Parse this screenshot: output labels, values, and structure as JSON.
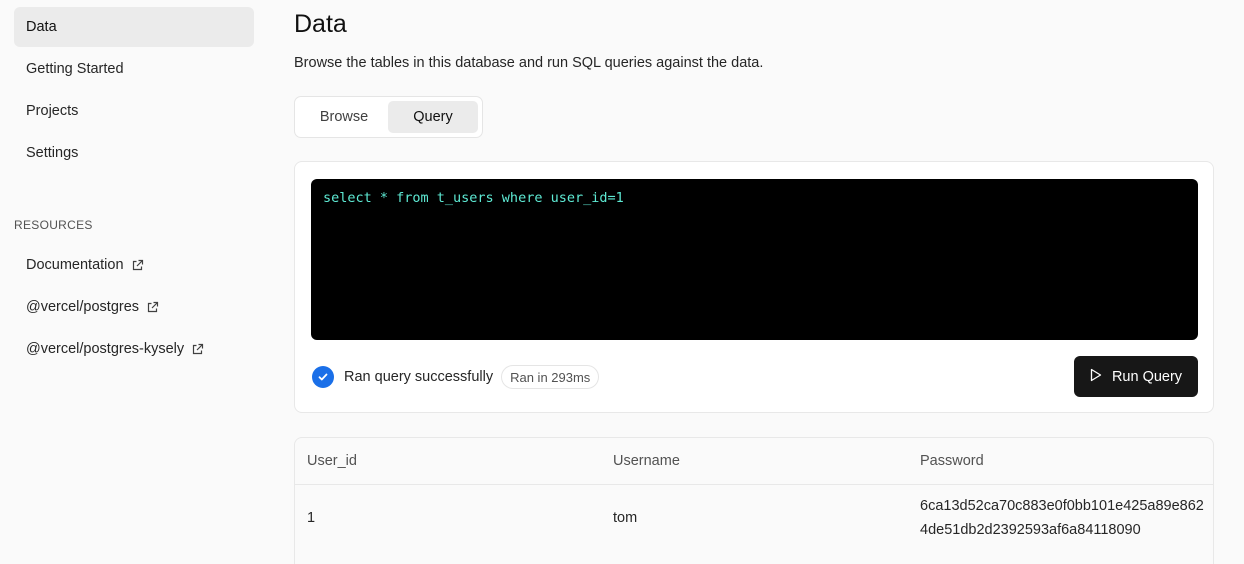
{
  "sidebar": {
    "items": [
      {
        "label": "Data",
        "active": true
      },
      {
        "label": "Getting Started",
        "active": false
      },
      {
        "label": "Projects",
        "active": false
      },
      {
        "label": "Settings",
        "active": false
      }
    ],
    "resources_heading": "RESOURCES",
    "resources": [
      {
        "label": "Documentation",
        "icon": "external-link-icon"
      },
      {
        "label": "@vercel/postgres",
        "icon": "external-link-icon"
      },
      {
        "label": "@vercel/postgres-kysely",
        "icon": "external-link-icon"
      }
    ]
  },
  "main": {
    "title": "Data",
    "description": "Browse the tables in this database and run SQL queries against the data.",
    "tabs": [
      {
        "label": "Browse",
        "active": false
      },
      {
        "label": "Query",
        "active": true
      }
    ],
    "query": {
      "sql": "select * from t_users where user_id=1",
      "status_text": "Ran query successfully",
      "time_badge": "Ran in 293ms",
      "run_label": "Run Query"
    },
    "results": {
      "columns": [
        "User_id",
        "Username",
        "Password"
      ],
      "rows": [
        [
          "1",
          "tom",
          "6ca13d52ca70c883e0f0bb101e425a89e8624de51db2d2392593af6a84118090"
        ]
      ]
    }
  },
  "colors": {
    "accent_blue": "#1a6fe8",
    "sql_text": "#5eead4",
    "button_bg": "#171717"
  }
}
